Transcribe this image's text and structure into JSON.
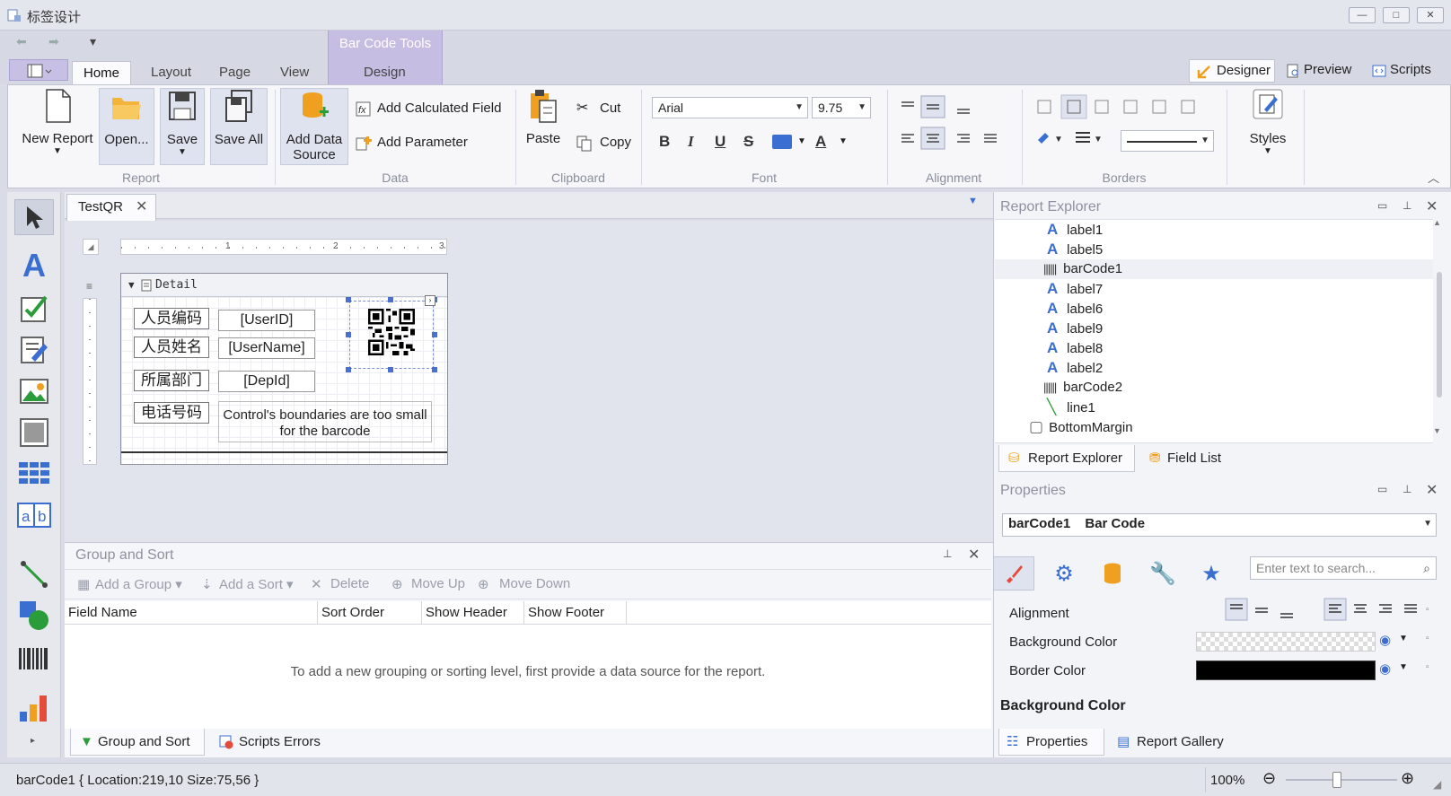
{
  "window": {
    "title": "标签设计",
    "min": "—",
    "max": "□",
    "close": "✕"
  },
  "ribbon": {
    "context_group": "Bar Code Tools",
    "tabs": [
      "Home",
      "Layout",
      "Page",
      "View",
      "Design"
    ],
    "view_buttons": [
      "Designer",
      "Preview",
      "Scripts"
    ],
    "groups": {
      "report": {
        "label": "Report",
        "new_report": "New Report",
        "open": "Open...",
        "save": "Save",
        "save_all": "Save All"
      },
      "data": {
        "label": "Data",
        "add_data_source": "Add Data Source",
        "add_calculated_field": "Add Calculated Field",
        "add_parameter": "Add Parameter"
      },
      "clipboard": {
        "label": "Clipboard",
        "paste": "Paste",
        "cut": "Cut",
        "copy": "Copy"
      },
      "font": {
        "label": "Font",
        "font_name": "Arial",
        "font_size": "9.75"
      },
      "alignment": {
        "label": "Alignment"
      },
      "borders": {
        "label": "Borders"
      },
      "styles": {
        "label": "Styles"
      }
    }
  },
  "document": {
    "tab": "TestQR",
    "band": "Detail",
    "ruler": [
      "1",
      "2",
      "3"
    ],
    "labels": [
      {
        "caption": "人员编码",
        "field": "[UserID]"
      },
      {
        "caption": "人员姓名",
        "field": "[UserName]"
      },
      {
        "caption": "所属部门",
        "field": "[DepId]"
      },
      {
        "caption": "电话号码",
        "field": "Control's boundaries are too small for the barcode"
      }
    ]
  },
  "group_sort": {
    "title": "Group and Sort",
    "toolbar": [
      "Add a Group",
      "Add a Sort",
      "Delete",
      "Move Up",
      "Move Down"
    ],
    "columns": [
      "Field Name",
      "Sort Order",
      "Show Header",
      "Show Footer"
    ],
    "empty_message": "To add a new grouping or sorting level, first provide a data source for the report.",
    "bottom_tabs": [
      "Group and Sort",
      "Scripts Errors"
    ]
  },
  "report_explorer": {
    "title": "Report Explorer",
    "items": [
      {
        "icon": "label",
        "name": "label1"
      },
      {
        "icon": "label",
        "name": "label5"
      },
      {
        "icon": "barcode",
        "name": "barCode1",
        "selected": true
      },
      {
        "icon": "label",
        "name": "label7"
      },
      {
        "icon": "label",
        "name": "label6"
      },
      {
        "icon": "label",
        "name": "label9"
      },
      {
        "icon": "label",
        "name": "label8"
      },
      {
        "icon": "label",
        "name": "label2"
      },
      {
        "icon": "barcode",
        "name": "barCode2"
      },
      {
        "icon": "line",
        "name": "line1"
      },
      {
        "icon": "band",
        "name": "BottomMargin"
      }
    ],
    "tabs": [
      "Report Explorer",
      "Field List"
    ]
  },
  "properties": {
    "title": "Properties",
    "object_name": "barCode1",
    "object_type": "Bar Code",
    "search_placeholder": "Enter text to search...",
    "rows": [
      {
        "name": "Alignment"
      },
      {
        "name": "Background Color"
      },
      {
        "name": "Border Color"
      }
    ],
    "description_title": "Background Color",
    "tabs": [
      "Properties",
      "Report Gallery"
    ]
  },
  "status": {
    "text": "barCode1 { Location:219,10 Size:75,56 }",
    "zoom": "100%"
  },
  "colors": {
    "accent": "#f0a020",
    "ribbon_context": "#c6bde3",
    "label_icon": "#3a6fd1"
  }
}
